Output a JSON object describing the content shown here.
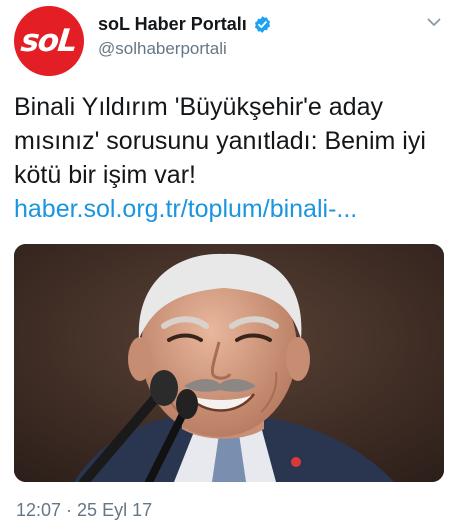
{
  "account": {
    "avatar_text": "soL",
    "display_name": "soL Haber Portalı",
    "handle": "@solhaberportali",
    "verified": true
  },
  "tweet": {
    "text": "Binali Yıldırım 'Büyükşehir'e aday mısınız' sorusunu yanıtladı: Benim iyi kötü bir işim var!",
    "link": "haber.sol.org.tr/toplum/binali-..."
  },
  "meta": {
    "timestamp": "12:07 · 25 Eyl 17"
  },
  "colors": {
    "brand_red": "#e31e24",
    "link_blue": "#1b95e0",
    "verified_blue": "#1da1f2",
    "muted_gray": "#657786"
  },
  "icons": {
    "verified": "verified-badge-icon",
    "menu": "chevron-down-icon"
  }
}
